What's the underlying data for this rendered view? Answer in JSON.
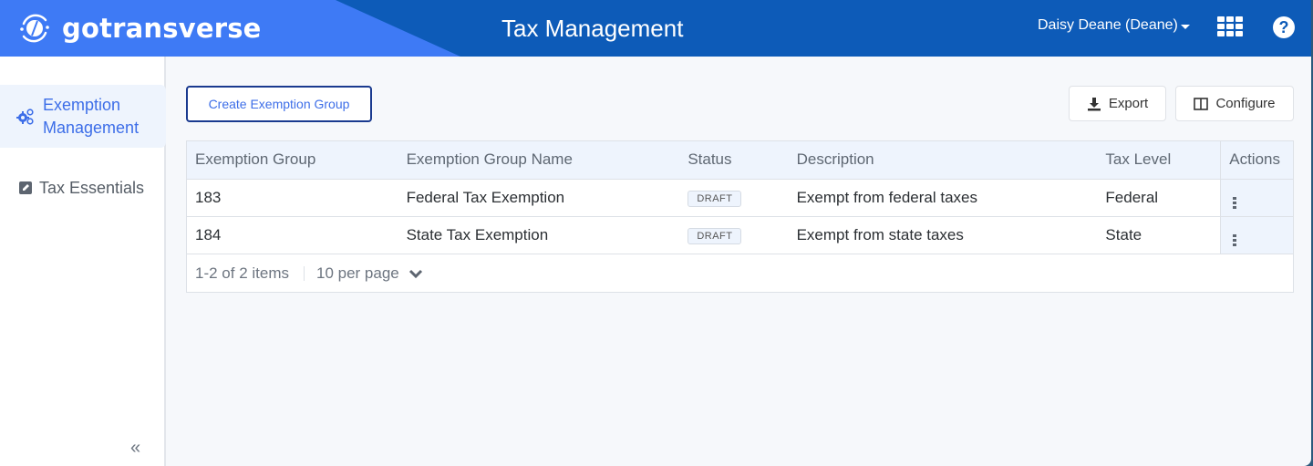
{
  "header": {
    "logo_text": "gotransverse",
    "title": "Tax Management",
    "user_menu_label": "Daisy Deane (Deane)",
    "icons": {
      "apps": "apps-grid-icon",
      "help": "question-circle-icon",
      "help_glyph": "?"
    }
  },
  "sidebar": {
    "items": [
      {
        "label": "Exemption Management",
        "icon": "cogs-icon",
        "active": true
      },
      {
        "label": "Tax Essentials",
        "icon": "edit-icon",
        "active": false
      }
    ],
    "collapse_glyph": "«"
  },
  "toolbar": {
    "create_label": "Create Exemption Group",
    "export_label": "Export",
    "configure_label": "Configure"
  },
  "grid": {
    "columns": [
      "Exemption Group",
      "Exemption Group Name",
      "Status",
      "Description",
      "Tax Level",
      "Actions"
    ],
    "rows": [
      {
        "id": "183",
        "name": "Federal Tax Exemption",
        "status": "DRAFT",
        "description": "Exempt from federal taxes",
        "tax_level": "Federal"
      },
      {
        "id": "184",
        "name": "State Tax Exemption",
        "status": "DRAFT",
        "description": "Exempt from state taxes",
        "tax_level": "State"
      }
    ],
    "pager": {
      "range": "1-2 of 2 items",
      "per_page": "10 per page"
    }
  },
  "colors": {
    "header_dark": "#0d5bb8",
    "header_light": "#3e7af5",
    "accent": "#3d6ee8",
    "button_border": "#1a3a8f"
  }
}
